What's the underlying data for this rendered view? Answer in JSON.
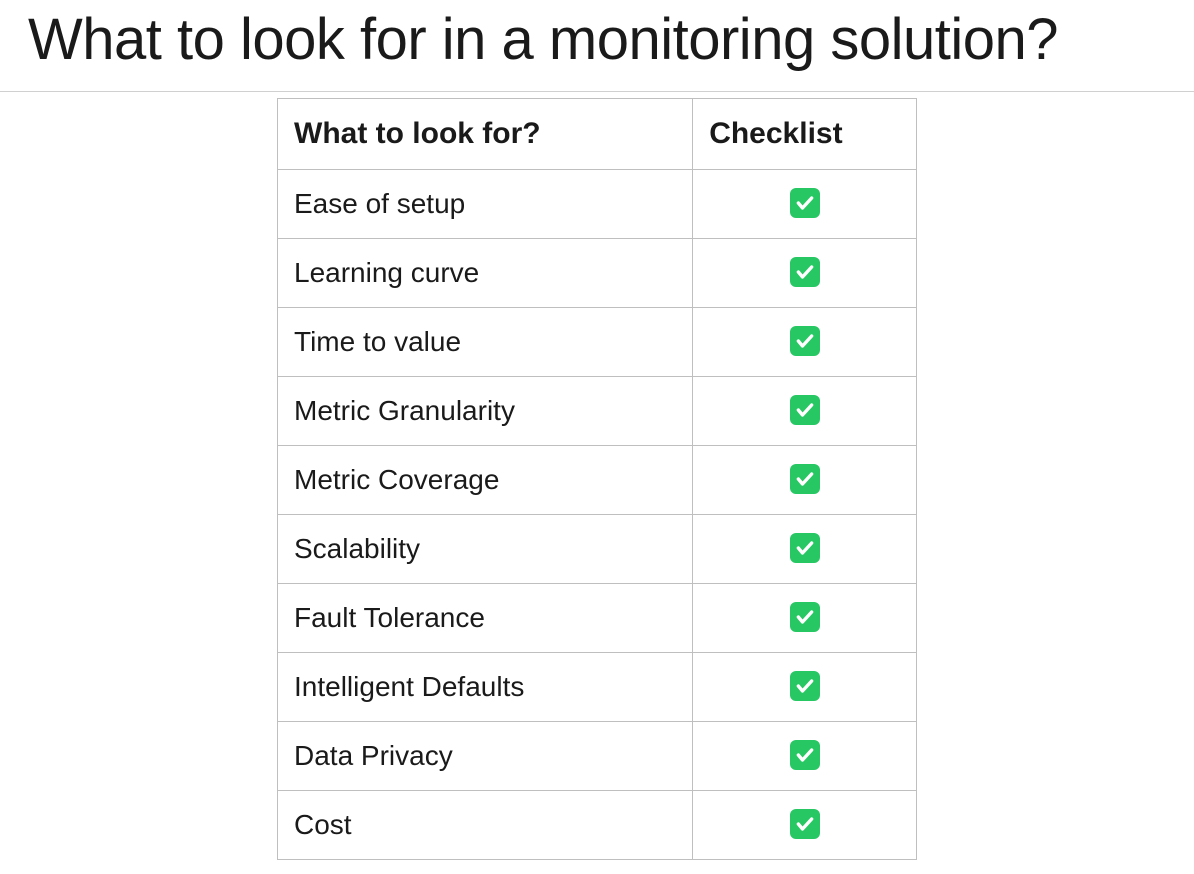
{
  "title": "What to look for in a monitoring solution?",
  "table": {
    "headers": {
      "col1": "What to look for?",
      "col2": "Checklist"
    },
    "rows": [
      {
        "label": "Ease of setup",
        "checked": true
      },
      {
        "label": "Learning curve",
        "checked": true
      },
      {
        "label": "Time to value",
        "checked": true
      },
      {
        "label": "Metric Granularity",
        "checked": true
      },
      {
        "label": "Metric Coverage",
        "checked": true
      },
      {
        "label": "Scalability",
        "checked": true
      },
      {
        "label": "Fault Tolerance",
        "checked": true
      },
      {
        "label": "Intelligent Defaults",
        "checked": true
      },
      {
        "label": "Data Privacy",
        "checked": true
      },
      {
        "label": "Cost",
        "checked": true
      }
    ]
  },
  "colors": {
    "check_bg": "#27c763",
    "check_fg": "#ffffff"
  }
}
